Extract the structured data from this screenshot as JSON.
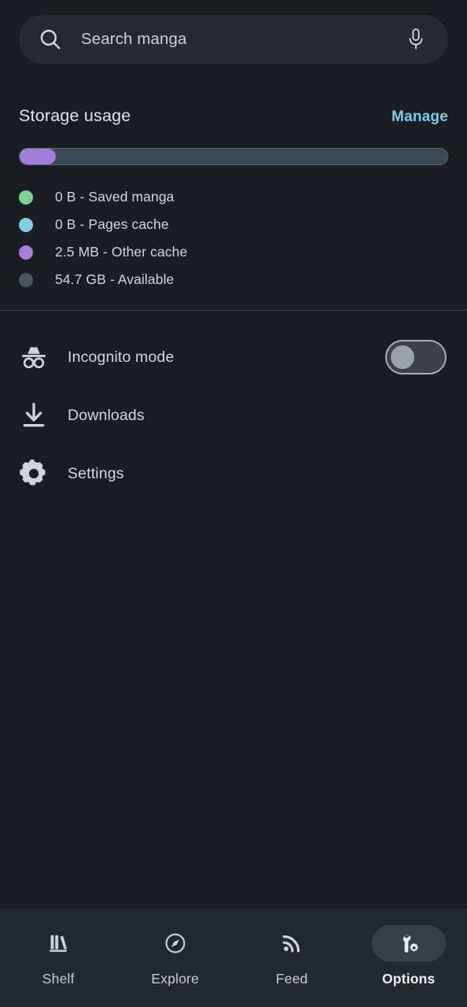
{
  "search": {
    "placeholder": "Search manga",
    "value": "",
    "search_icon": "search-icon",
    "mic_icon": "microphone-icon"
  },
  "storage": {
    "title": "Storage usage",
    "manage_label": "Manage",
    "manage_color": "#7ecbf2",
    "bar": {
      "track_color": "#3b4a55",
      "segments": [
        {
          "name": "Other cache",
          "percent": 8.4,
          "color": "#a57fde"
        },
        {
          "name": "Available",
          "percent": 91.6,
          "color": "#3b4a55"
        }
      ]
    },
    "legend": [
      {
        "label": "0 B - Saved manga",
        "color": "#7ed492"
      },
      {
        "label": "0 B - Pages cache",
        "color": "#7fcfdd"
      },
      {
        "label": "2.5 MB - Other cache",
        "color": "#a57fde"
      },
      {
        "label": "54.7 GB - Available",
        "color": "#46555f"
      }
    ]
  },
  "options": [
    {
      "label": "Incognito mode",
      "icon": "incognito-icon",
      "toggle": {
        "state": "off"
      }
    },
    {
      "label": "Downloads",
      "icon": "download-icon"
    },
    {
      "label": "Settings",
      "icon": "gear-icon"
    }
  ],
  "bottom_nav": {
    "items": [
      {
        "label": "Shelf",
        "icon": "bookshelf-icon",
        "active": false
      },
      {
        "label": "Explore",
        "icon": "compass-icon",
        "active": false
      },
      {
        "label": "Feed",
        "icon": "rss-icon",
        "active": false
      },
      {
        "label": "Options",
        "icon": "wrench-gear-icon",
        "active": true
      }
    ],
    "active_pill_color": "#364149"
  }
}
